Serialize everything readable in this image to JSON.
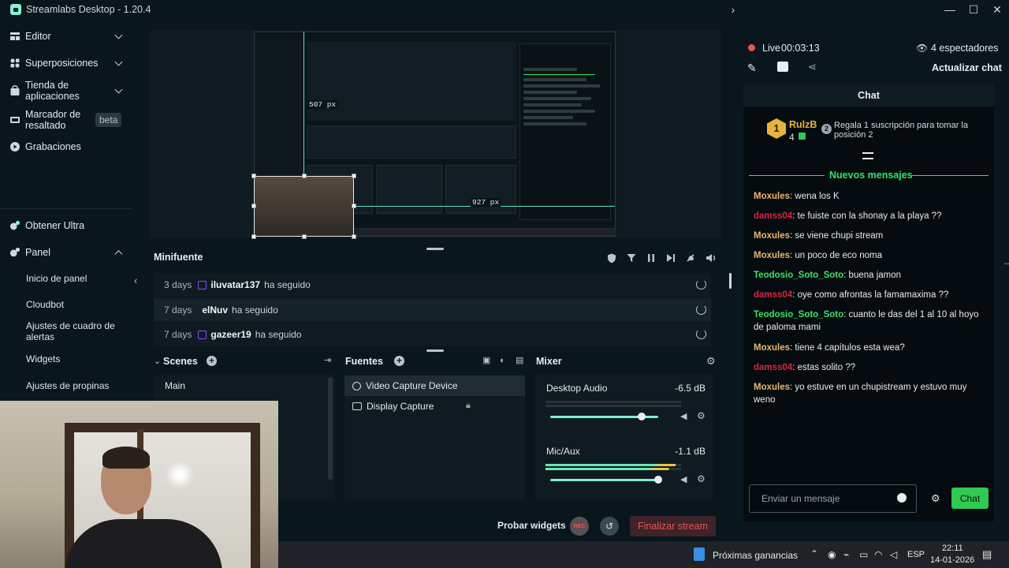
{
  "window": {
    "title": "Streamlabs Desktop - 1.20.4"
  },
  "sidebar": {
    "items": [
      {
        "label": "Editor"
      },
      {
        "label": "Superposiciones"
      },
      {
        "label": "Tienda de aplicaciones"
      },
      {
        "label": "Marcador de resaltado",
        "badge": "beta"
      },
      {
        "label": "Grabaciones"
      },
      {
        "label": "Obtener Ultra"
      },
      {
        "label": "Panel"
      }
    ],
    "panel_subitems": [
      "Inicio de panel",
      "Cloudbot",
      "Ajustes de cuadro de alertas",
      "Widgets",
      "Ajustes de propinas"
    ]
  },
  "preview": {
    "guide_labels": [
      "507 px",
      "927 px"
    ]
  },
  "minifeed": {
    "title": "Minifuente",
    "rows": [
      {
        "time": "3 days",
        "user": "iluvatar137",
        "action": "ha seguido"
      },
      {
        "time": "7 days",
        "user": "elNuv",
        "action": "ha seguido"
      },
      {
        "time": "7 days",
        "user": "gazeer19",
        "action": "ha seguido"
      }
    ]
  },
  "scenes": {
    "title": "Scenes",
    "items": [
      "Main"
    ]
  },
  "sources": {
    "title": "Fuentes",
    "items": [
      "Video Capture Device",
      "Display Capture"
    ]
  },
  "mixer": {
    "title": "Mixer",
    "channels": [
      {
        "name": "Desktop Audio",
        "db": "-6.5 dB",
        "volume": 0.85
      },
      {
        "name": "Mic/Aux",
        "db": "-1.1 dB",
        "volume": 1.0
      }
    ]
  },
  "footer": {
    "test_widgets": "Probar widgets",
    "rec": "REC",
    "end_stream": "Finalizar stream"
  },
  "stream": {
    "live_label": "Live",
    "timer": "00:03:13",
    "viewers": "4 espectadores",
    "refresh_chat": "Actualizar chat"
  },
  "chat": {
    "title": "Chat",
    "top_supporter": {
      "rank": "1",
      "name": "RulzB",
      "count": "4",
      "gift_count": "2",
      "gift_text": "Regala 1 suscripción para tomar la posición 2"
    },
    "new_messages_label": "Nuevos mensajes",
    "messages": [
      {
        "user": "Moxules",
        "text": "wena los K",
        "color": "#e8b86b"
      },
      {
        "user": "damss04",
        "text": "te fuiste con la shonay a la playa ??",
        "color": "#e0243c"
      },
      {
        "user": "Moxules",
        "text": "se viene chupi stream",
        "color": "#e8b86b"
      },
      {
        "user": "Moxules",
        "text": "un poco de eco noma",
        "color": "#e8b86b"
      },
      {
        "user": "Teodosio_Soto_Soto",
        "text": "buena jamon",
        "color": "#3ee36a"
      },
      {
        "user": "damss04",
        "text": "oye como afrontas la famamaxima ??",
        "color": "#e0243c"
      },
      {
        "user": "Teodosio_Soto_Soto",
        "text": "cuanto le das del 1 al 10 al hoyo de paloma mami",
        "color": "#3ee36a"
      },
      {
        "user": "Moxules",
        "text": "tiene 4 capítulos esta wea?",
        "color": "#e8b86b"
      },
      {
        "user": "damss04",
        "text": "estas solito ??",
        "color": "#e0243c"
      },
      {
        "user": "Moxules",
        "text": "yo estuve en un chupistream y estuvo muy weno",
        "color": "#e8b86b"
      }
    ],
    "input_placeholder": "Enviar un mensaje",
    "send_label": "Chat"
  },
  "taskbar": {
    "earnings": "Próximas ganancias",
    "lang": "ESP",
    "time": "22:11",
    "date": "14-01-2026"
  },
  "colors": {
    "accent": "#80f5d2",
    "live_red": "#ea5455",
    "chat_green": "#31c953"
  }
}
